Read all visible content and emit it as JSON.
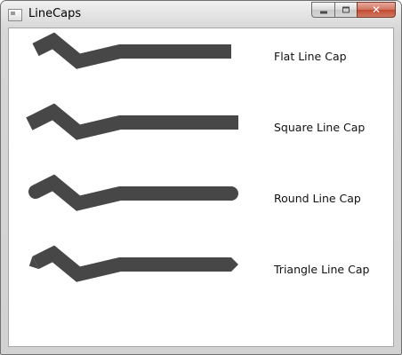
{
  "window": {
    "title": "LineCaps",
    "icon": "app-window-icon",
    "caption_buttons": [
      "minimize-icon",
      "maximize-icon",
      "close-icon"
    ]
  },
  "line_color": "#474747",
  "rows": [
    {
      "label": "Flat Line Cap",
      "cap": "flat"
    },
    {
      "label": "Square Line Cap",
      "cap": "square"
    },
    {
      "label": "Round Line Cap",
      "cap": "round"
    },
    {
      "label": "Triangle Line Cap",
      "cap": "triangle"
    }
  ]
}
